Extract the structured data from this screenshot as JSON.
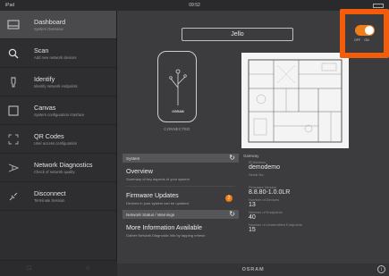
{
  "statusbar": {
    "left": "iPad",
    "time": "09:52"
  },
  "sidebar": {
    "items": [
      {
        "label": "Dashboard",
        "sub": "System Overview",
        "icon": "dashboard-icon"
      },
      {
        "label": "Scan",
        "sub": "Add new network devices",
        "icon": "search-icon"
      },
      {
        "label": "Identify",
        "sub": "Identify network endpoints",
        "icon": "bulb-icon"
      },
      {
        "label": "Canvas",
        "sub": "System configuration interface",
        "icon": "canvas-icon"
      },
      {
        "label": "QR Codes",
        "sub": "User access configuration",
        "icon": "qr-icon"
      },
      {
        "label": "Network Diagnostics",
        "sub": "Check of network quality",
        "icon": "network-icon"
      },
      {
        "label": "Disconnect",
        "sub": "Terminate Session",
        "icon": "disconnect-icon"
      }
    ]
  },
  "header": {
    "name_field": "Jello"
  },
  "toggle": {
    "off_label": "OFF",
    "on_label": "ON",
    "state": "on"
  },
  "device": {
    "status": "CONNECTED",
    "brand_mark": "OSRAM"
  },
  "system": {
    "header": "System",
    "overview_title": "Overview",
    "overview_sub": "Summary of key aspects of your system",
    "firmware_title": "Firmware Updates",
    "firmware_sub": "Devices in your system can be updated",
    "firmware_badge": "2"
  },
  "network": {
    "header": "Network Status / Warnings",
    "title": "More Information Available",
    "sub": "Gather Network Diagnostic info by tapping refresh"
  },
  "gateway": {
    "header": "Gateway",
    "ip_label": "IP Address",
    "ip_value": "demodemo",
    "serial_label": "Serial No.",
    "firmware_label": "Firmware Version",
    "firmware_value": "8.8.80-1.0.0LR",
    "devices_label": "Number of Devices",
    "devices_value": "13",
    "endpoints_label": "Number of Endpoints",
    "endpoints_value": "40",
    "unidentified_label": "Number of Unidentified Endpoints",
    "unidentified_value": "15"
  },
  "footer": {
    "brand": "OSRAM",
    "info": "i"
  },
  "colors": {
    "accent": "#f25c0a",
    "toggle": "#ef7d1a",
    "badge": "#f07c18"
  }
}
